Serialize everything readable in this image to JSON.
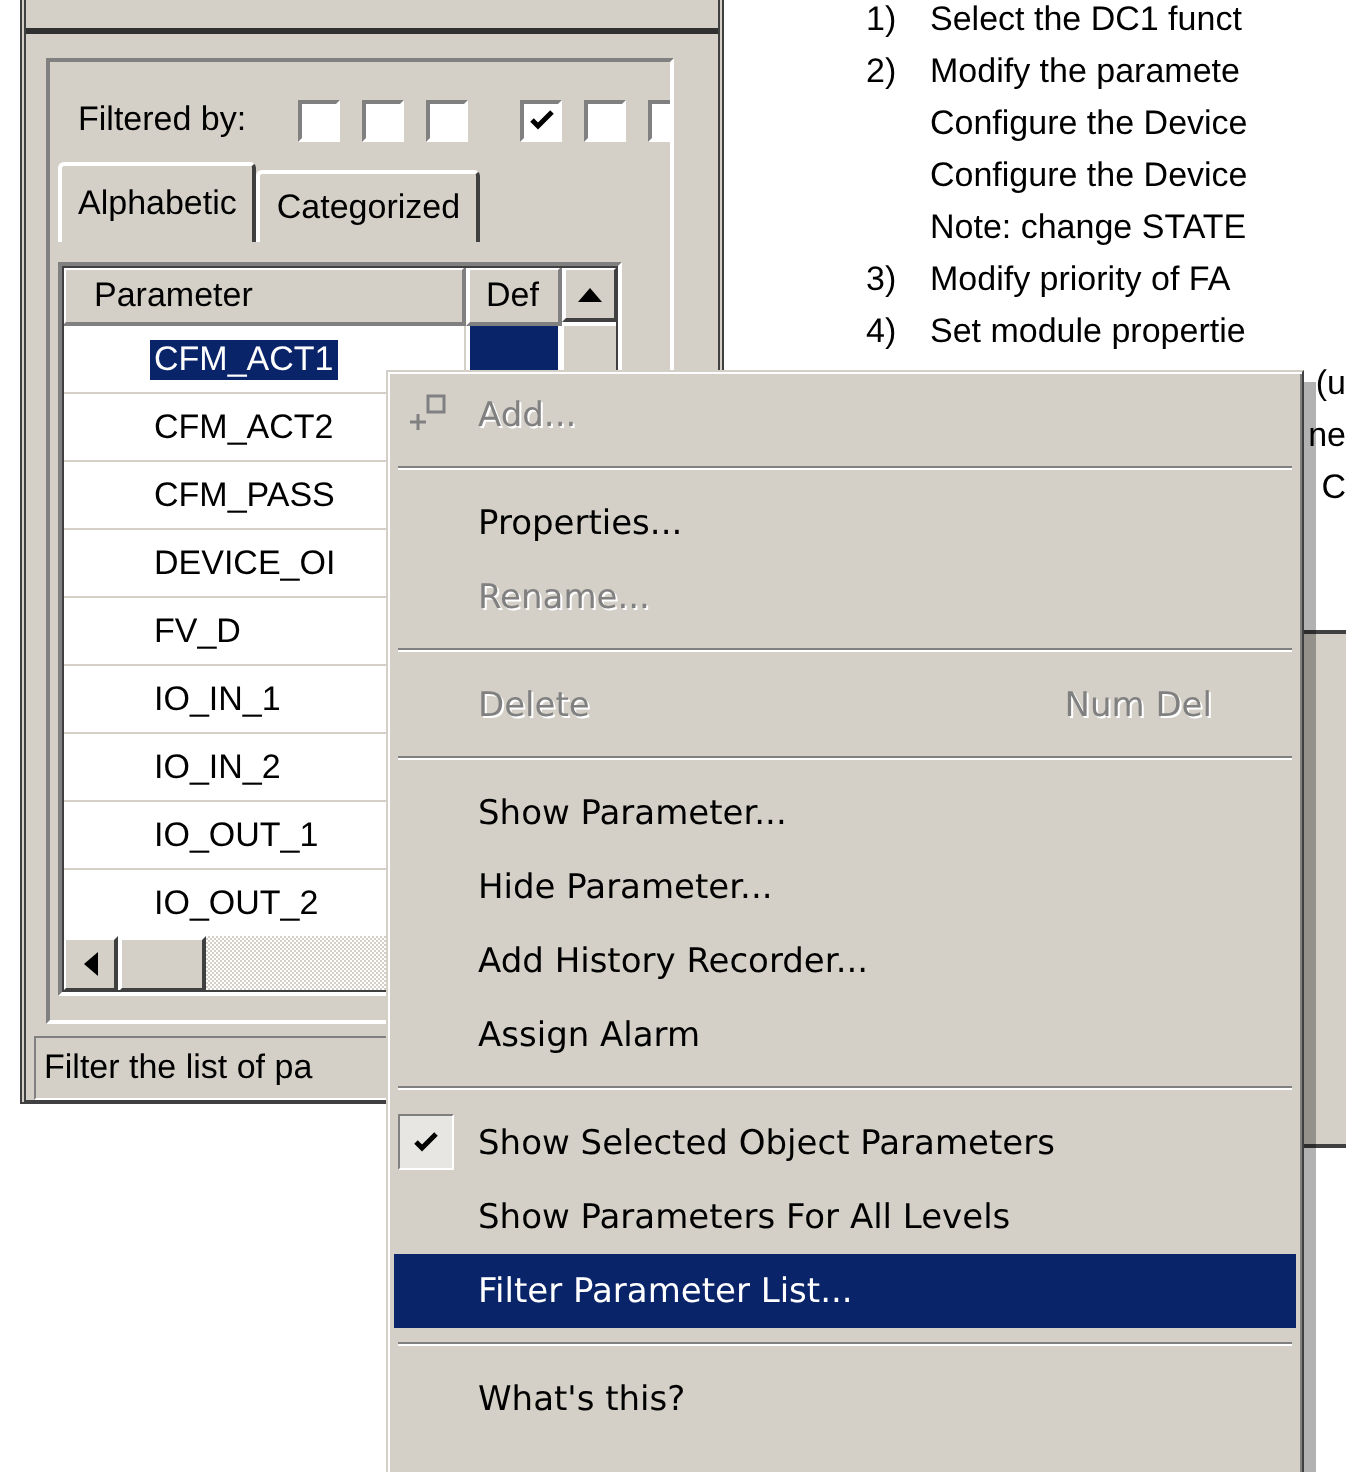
{
  "left_panel": {
    "filter_label": "Filtered by:",
    "filter_groups": [
      [
        {
          "checked": false
        },
        {
          "checked": false
        },
        {
          "checked": false
        }
      ],
      [
        {
          "checked": true
        },
        {
          "checked": false
        },
        {
          "checked": false
        }
      ]
    ],
    "tabs": [
      {
        "label": "Alphabetic",
        "selected": true
      },
      {
        "label": "Categorized",
        "selected": false
      }
    ],
    "table": {
      "columns": [
        "Parameter",
        "Def"
      ],
      "rows": [
        {
          "name": "CFM_ACT1",
          "selected": true
        },
        {
          "name": "CFM_ACT2",
          "selected": false
        },
        {
          "name": "CFM_PASS",
          "selected": false
        },
        {
          "name": "DEVICE_OI",
          "selected": false
        },
        {
          "name": "FV_D",
          "selected": false
        },
        {
          "name": "IO_IN_1",
          "selected": false
        },
        {
          "name": "IO_IN_2",
          "selected": false
        },
        {
          "name": "IO_OUT_1",
          "selected": false
        },
        {
          "name": "IO_OUT_2",
          "selected": false
        }
      ]
    },
    "status_bar": "Filter the list of pa"
  },
  "instructions": [
    {
      "kind": "numbered",
      "number": "1)",
      "text": "Select the DC1  funct"
    },
    {
      "kind": "numbered",
      "number": "2)",
      "text": "Modify the paramete"
    },
    {
      "kind": "continuation",
      "text": "Configure the Device"
    },
    {
      "kind": "continuation",
      "text": "Configure the Device"
    },
    {
      "kind": "continuation",
      "text": "Note: change STATE"
    },
    {
      "kind": "numbered",
      "number": "3)",
      "text": "Modify priority of FA"
    },
    {
      "kind": "numbered",
      "number": "4)",
      "text": "Set module propertie"
    },
    {
      "kind": "fragment",
      "text": "(u"
    },
    {
      "kind": "fragment",
      "text": "ne"
    },
    {
      "kind": "fragment",
      "text": "C"
    }
  ],
  "context_menu": {
    "items": [
      {
        "kind": "icon_item",
        "label": "Add...",
        "disabled": true,
        "selected": false
      },
      {
        "kind": "separator"
      },
      {
        "kind": "item",
        "label": "Properties...",
        "disabled": false,
        "selected": false
      },
      {
        "kind": "item",
        "label": "Rename...",
        "disabled": true,
        "selected": false
      },
      {
        "kind": "separator"
      },
      {
        "kind": "item",
        "label": "Delete",
        "shortcut": "Num Del",
        "disabled": true,
        "selected": false
      },
      {
        "kind": "separator"
      },
      {
        "kind": "item",
        "label": "Show Parameter...",
        "disabled": false,
        "selected": false
      },
      {
        "kind": "item",
        "label": "Hide Parameter...",
        "disabled": false,
        "selected": false
      },
      {
        "kind": "item",
        "label": "Add History Recorder...",
        "disabled": false,
        "selected": false
      },
      {
        "kind": "item",
        "label": "Assign Alarm",
        "disabled": false,
        "selected": false
      },
      {
        "kind": "separator"
      },
      {
        "kind": "check_item",
        "label": "Show Selected Object Parameters",
        "checked": true,
        "disabled": false,
        "selected": false
      },
      {
        "kind": "check_item",
        "label": "Show Parameters For All Levels",
        "checked": false,
        "disabled": false,
        "selected": false
      },
      {
        "kind": "item",
        "label": "Filter Parameter List...",
        "disabled": false,
        "selected": true
      },
      {
        "kind": "separator"
      },
      {
        "kind": "item",
        "label": "What's this?",
        "disabled": false,
        "selected": false
      }
    ]
  }
}
